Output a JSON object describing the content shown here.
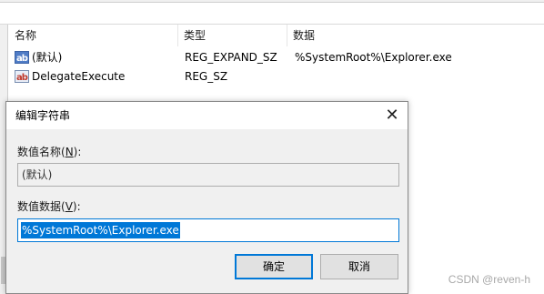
{
  "list": {
    "columns": {
      "name": "名称",
      "type": "类型",
      "data": "数据"
    },
    "rows": [
      {
        "icon": "ab-string-icon",
        "name": "(默认)",
        "type": "REG_EXPAND_SZ",
        "value": "%SystemRoot%\\Explorer.exe"
      },
      {
        "icon": "ab-string-icon",
        "name": "DelegateExecute",
        "type": "REG_SZ",
        "value": ""
      }
    ]
  },
  "dialog": {
    "title": "编辑字符串",
    "close_glyph": "✕",
    "name_label": "数值名称(",
    "name_label_key": "N",
    "name_label_tail": "):",
    "name_value": "(默认)",
    "data_label": "数值数据(",
    "data_label_key": "V",
    "data_label_tail": "):",
    "data_value": "%SystemRoot%\\Explorer.exe",
    "ok_label": "确定",
    "cancel_label": "取消"
  },
  "watermark": "CSDN @reven-h",
  "colors": {
    "accent": "#0078d7",
    "dialog_bg": "#f0f0f0",
    "button_bg": "#e1e1e1"
  }
}
